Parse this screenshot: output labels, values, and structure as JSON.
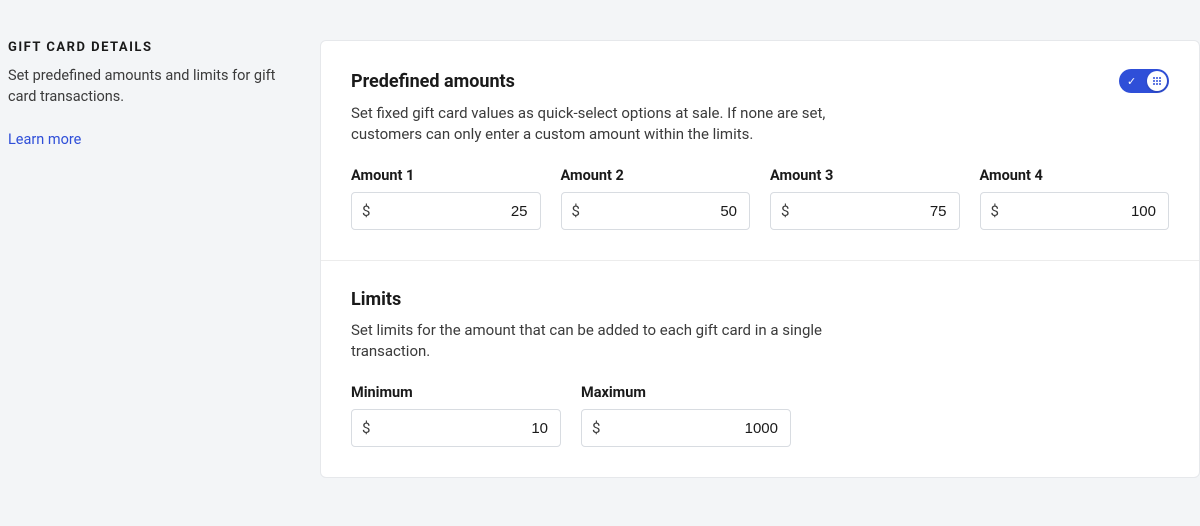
{
  "sidebar": {
    "heading": "GIFT CARD DETAILS",
    "description": "Set predefined amounts and limits for gift card transactions.",
    "learn_more": "Learn more"
  },
  "predefined": {
    "title": "Predefined amounts",
    "description": "Set fixed gift card values as quick-select options at sale. If none are set, customers can only enter a custom amount within the limits.",
    "toggle_on": true,
    "currency_symbol": "$",
    "amounts": [
      {
        "label": "Amount 1",
        "value": "25"
      },
      {
        "label": "Amount 2",
        "value": "50"
      },
      {
        "label": "Amount 3",
        "value": "75"
      },
      {
        "label": "Amount 4",
        "value": "100"
      }
    ]
  },
  "limits": {
    "title": "Limits",
    "description": "Set limits for the amount that can be added to each gift card in a single transaction.",
    "currency_symbol": "$",
    "minimum": {
      "label": "Minimum",
      "value": "10"
    },
    "maximum": {
      "label": "Maximum",
      "value": "1000"
    }
  }
}
